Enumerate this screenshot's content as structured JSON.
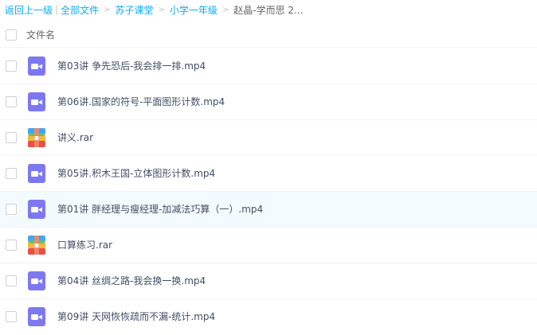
{
  "breadcrumb": {
    "back": "返回上一级",
    "separator": "|",
    "items": [
      {
        "label": "全部文件"
      },
      {
        "label": "苏子课堂"
      },
      {
        "label": "小学一年级"
      },
      {
        "label": "赵晶-学而思 2..."
      }
    ]
  },
  "header": {
    "column_name": "文件名"
  },
  "files": [
    {
      "name": "第03讲 争先恐后-我会排一排.mp4",
      "type": "video"
    },
    {
      "name": "第06讲.国家的符号-平面图形计数.mp4",
      "type": "video"
    },
    {
      "name": "讲义.rar",
      "type": "archive"
    },
    {
      "name": "第05讲.积木王国-立体图形计数.mp4",
      "type": "video"
    },
    {
      "name": "第01讲 胖经理与瘦经理-加减法巧算（一）.mp4",
      "type": "video"
    },
    {
      "name": "口算练习.rar",
      "type": "archive"
    },
    {
      "name": "第04讲 丝绸之路-我会换一换.mp4",
      "type": "video"
    },
    {
      "name": "第09讲 天网恢恢疏而不漏-统计.mp4",
      "type": "video"
    }
  ],
  "colors": {
    "link": "#09aaff",
    "video_icon": "#7e78f0",
    "row_hover": "#f4fbff"
  }
}
